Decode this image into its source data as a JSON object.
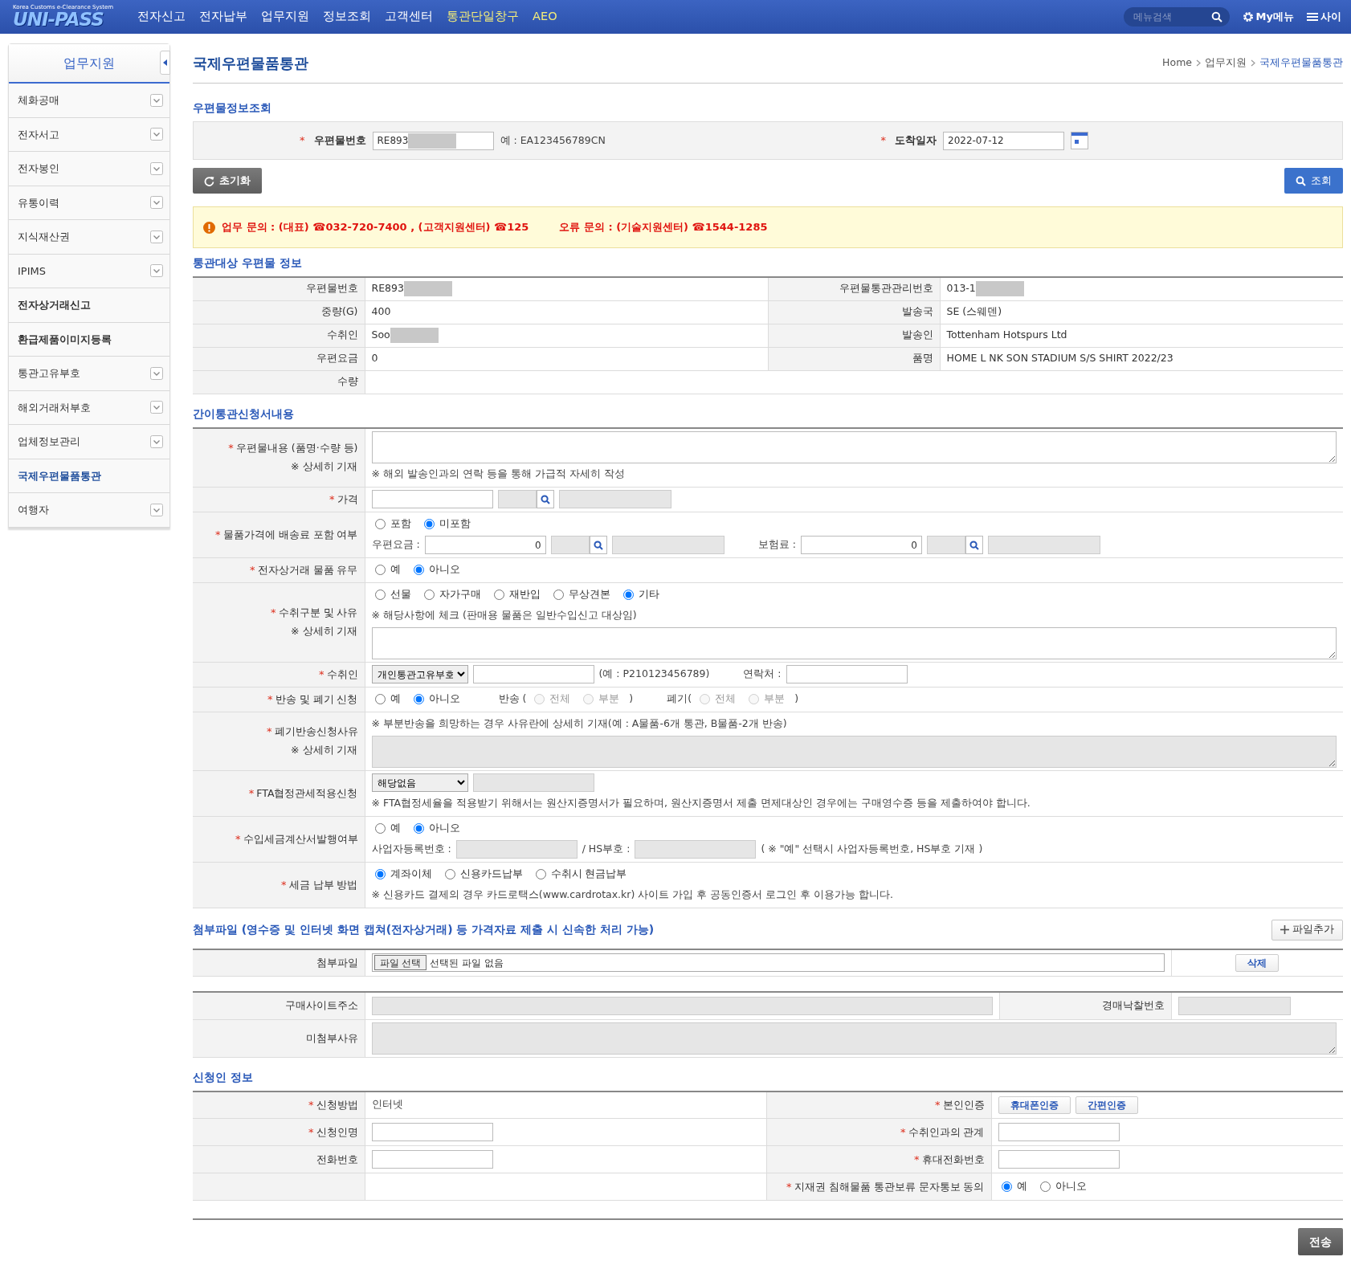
{
  "topbar": {
    "logo": "UNI-PASS",
    "logo_sub": "Korea Customs e-Clearance System",
    "menu": [
      {
        "label": "전자신고",
        "highlight": false
      },
      {
        "label": "전자납부",
        "highlight": false
      },
      {
        "label": "업무지원",
        "highlight": false
      },
      {
        "label": "정보조회",
        "highlight": false
      },
      {
        "label": "고객센터",
        "highlight": false
      },
      {
        "label": "통관단일창구",
        "highlight": true
      },
      {
        "label": "AEO",
        "highlight": true
      }
    ],
    "search": {
      "placeholder": "메뉴검색"
    },
    "my_menu": "My메뉴",
    "sitemap": "사이"
  },
  "sidebar": {
    "title": "업무지원",
    "items": [
      {
        "label": "체화공매",
        "expandable": true,
        "selected": false
      },
      {
        "label": "전자서고",
        "expandable": true,
        "selected": false
      },
      {
        "label": "전자봉인",
        "expandable": true,
        "selected": false
      },
      {
        "label": "유통이력",
        "expandable": true,
        "selected": false
      },
      {
        "label": "지식재산권",
        "expandable": true,
        "selected": false
      },
      {
        "label": "IPIMS",
        "expandable": true,
        "selected": false
      },
      {
        "label": "전자상거래신고",
        "expandable": false,
        "selected": false
      },
      {
        "label": "환급제품이미지등록",
        "expandable": false,
        "selected": false
      },
      {
        "label": "통관고유부호",
        "expandable": true,
        "selected": false
      },
      {
        "label": "해외거래처부호",
        "expandable": true,
        "selected": false
      },
      {
        "label": "업체정보관리",
        "expandable": true,
        "selected": false
      },
      {
        "label": "국제우편물품통관",
        "expandable": false,
        "selected": true
      },
      {
        "label": "여행자",
        "expandable": true,
        "selected": false
      }
    ]
  },
  "page": {
    "title": "국제우편물품통관",
    "breadcrumb": [
      {
        "label": "Home",
        "current": false
      },
      {
        "label": "업무지원",
        "current": false
      },
      {
        "label": "국제우편물품통관",
        "current": true
      }
    ]
  },
  "lookup": {
    "title": "우편물정보조회",
    "postal_no": {
      "star": "*",
      "label": "우편물번호",
      "value": "RE893",
      "masked": true,
      "example": "예 : EA123456789CN"
    },
    "arrival": {
      "star": "*",
      "label": "도착일자",
      "value": "2022-07-12"
    },
    "reset_button": "초기화",
    "search_button": "조회"
  },
  "notice": {
    "parts": [
      "업무 문의 : (대표) ☎032-720-7400 , (고객지원센터) ☎125",
      "오류 문의 : (기술지원센터) ☎1544-1285"
    ]
  },
  "info": {
    "title": "통관대상 우편물 정보",
    "rows": [
      [
        {
          "label": "우편물번호",
          "value": "RE893",
          "masked": true
        },
        {
          "label": "우편물통관관리번호",
          "value": "013-1",
          "masked": true
        }
      ],
      [
        {
          "label": "중량(G)",
          "value": "400",
          "masked": false
        },
        {
          "label": "발송국",
          "value": "SE (스웨덴)",
          "masked": false
        }
      ],
      [
        {
          "label": "수취인",
          "value": "Soo",
          "masked": true
        },
        {
          "label": "발송인",
          "value": "Tottenham Hotspurs Ltd",
          "masked": false
        }
      ],
      [
        {
          "label": "우편요금",
          "value": "0",
          "masked": false
        },
        {
          "label": "품명",
          "value": "HOME L NK SON STADIUM S/S SHIRT 2022/23",
          "masked": false
        }
      ],
      [
        {
          "label": "수량",
          "masked": false
        }
      ]
    ]
  },
  "form": {
    "title": "간이통관신청서내용",
    "rows": [
      {
        "star": "*",
        "label": "우편물내용 (품명·수량 등)",
        "note": "※ 상세히 기재",
        "lines": [
          [
            {
              "kind": "textarea",
              "disabled": false
            }
          ],
          [
            {
              "kind": "note",
              "text": "※ 해외 발송인과의 연락 등을 통해 가급적 자세히 작성"
            }
          ]
        ]
      },
      {
        "star": "*",
        "label": "가격",
        "lines": [
          [
            {
              "kind": "input",
              "disabled": false
            },
            {
              "kind": "lookup"
            }
          ]
        ]
      },
      {
        "star": "*",
        "label": "물품가격에 배송료 포함 여부",
        "lines": [
          [
            {
              "kind": "radio",
              "label": "포함",
              "checked": false,
              "disabled": false
            },
            {
              "kind": "radio",
              "label": "미포함",
              "checked": true,
              "disabled": false
            }
          ],
          [
            {
              "kind": "text",
              "text": "우편요금 :"
            },
            {
              "kind": "amount",
              "value": "0"
            },
            {
              "kind": "lookup"
            },
            {
              "kind": "gap"
            },
            {
              "kind": "text",
              "text": "보험료 :"
            },
            {
              "kind": "amount",
              "value": "0"
            },
            {
              "kind": "lookup"
            }
          ]
        ]
      },
      {
        "star": "*",
        "label": "전자상거래 물품 유무",
        "lines": [
          [
            {
              "kind": "radio",
              "label": "예",
              "checked": false,
              "disabled": false
            },
            {
              "kind": "radio",
              "label": "아니오",
              "checked": true,
              "disabled": false
            }
          ]
        ]
      },
      {
        "star": "*",
        "label": "수취구분 및 사유",
        "note": "※ 상세히 기재",
        "lines": [
          [
            {
              "kind": "radio",
              "label": "선물",
              "checked": false,
              "disabled": false
            },
            {
              "kind": "radio",
              "label": "자가구매",
              "checked": false,
              "disabled": false
            },
            {
              "kind": "radio",
              "label": "재반입",
              "checked": false,
              "disabled": false
            },
            {
              "kind": "radio",
              "label": "무상견본",
              "checked": false,
              "disabled": false
            },
            {
              "kind": "radio",
              "label": "기타",
              "checked": true,
              "disabled": false
            }
          ],
          [
            {
              "kind": "note",
              "text": "※ 해당사항에 체크 (판매용 물품은 일반수입신고 대상임)"
            }
          ],
          [
            {
              "kind": "textarea",
              "disabled": false
            }
          ]
        ]
      },
      {
        "star": "*",
        "label": "수취인",
        "lines": [
          [
            {
              "kind": "select",
              "value": "개인통관고유부호"
            },
            {
              "kind": "input",
              "disabled": false
            },
            {
              "kind": "text",
              "text": "(예 : P210123456789)"
            },
            {
              "kind": "gap"
            },
            {
              "kind": "text",
              "text": "연락처 :"
            },
            {
              "kind": "input",
              "disabled": false
            }
          ]
        ]
      },
      {
        "star": "*",
        "label": "반송 및 폐기 신청",
        "lines": [
          [
            {
              "kind": "radio",
              "label": "예",
              "checked": false,
              "disabled": false
            },
            {
              "kind": "radio",
              "label": "아니오",
              "checked": true,
              "disabled": false
            },
            {
              "kind": "gap"
            },
            {
              "kind": "text",
              "text": "반송 ("
            },
            {
              "kind": "radio",
              "label": "전체",
              "checked": false,
              "disabled": true
            },
            {
              "kind": "radio",
              "label": "부분",
              "checked": false,
              "disabled": true
            },
            {
              "kind": "text",
              "text": ")"
            },
            {
              "kind": "gap"
            },
            {
              "kind": "text",
              "text": "폐기("
            },
            {
              "kind": "radio",
              "label": "전체",
              "checked": false,
              "disabled": true
            },
            {
              "kind": "radio",
              "label": "부분",
              "checked": false,
              "disabled": true
            },
            {
              "kind": "text",
              "text": ")"
            }
          ]
        ]
      },
      {
        "star": "*",
        "label": "폐기반송신청사유",
        "note": "※ 상세히 기재",
        "lines": [
          [
            {
              "kind": "note",
              "text": "※ 부분반송을 희망하는 경우 사유란에 상세히 기재(예 : A물품-6개 통관, B물품-2개 반송)"
            }
          ],
          [
            {
              "kind": "textarea",
              "disabled": true
            }
          ]
        ]
      },
      {
        "star": "*",
        "label": "FTA협정관세적용신청",
        "lines": [
          [
            {
              "kind": "select",
              "value": "해당없음"
            },
            {
              "kind": "input",
              "disabled": true
            }
          ],
          [
            {
              "kind": "note",
              "text": "※ FTA협정세율을 적용받기 위해서는 원산지증명서가 필요하며, 원산지증명서 제출 면제대상인 경우에는 구매영수증 등을 제출하여야 합니다."
            }
          ]
        ]
      },
      {
        "star": "*",
        "label": "수입세금계산서발행여부",
        "lines": [
          [
            {
              "kind": "radio",
              "label": "예",
              "checked": false,
              "disabled": false
            },
            {
              "kind": "radio",
              "label": "아니오",
              "checked": true,
              "disabled": false
            }
          ],
          [
            {
              "kind": "text",
              "text": "사업자등록번호 :"
            },
            {
              "kind": "input",
              "disabled": true
            },
            {
              "kind": "text",
              "text": "/ HS부호 :"
            },
            {
              "kind": "input",
              "disabled": true
            },
            {
              "kind": "text",
              "text": "( ※ \"예\" 선택시 사업자등록번호, HS부호 기재 )"
            }
          ]
        ]
      },
      {
        "star": "*",
        "label": "세금 납부 방법",
        "lines": [
          [
            {
              "kind": "radio",
              "label": "계좌이체",
              "checked": true,
              "disabled": false
            },
            {
              "kind": "radio",
              "label": "신용카드납부",
              "checked": false,
              "disabled": false
            },
            {
              "kind": "radio",
              "label": "수취시 현금납부",
              "checked": false,
              "disabled": false
            }
          ],
          [
            {
              "kind": "note",
              "text": "※ 신용카드 결제의 경우 카드로택스(www.cardrotax.kr) 사이트 가입 후 공동인증서 로그인 후 이용가능 합니다."
            }
          ]
        ]
      }
    ]
  },
  "attachments": {
    "title": "첨부파일 (영수증 및 인터넷 화면 캡쳐(전자상거래) 등 가격자료 제출 시 신속한 처리 가능)",
    "add_button": "파일추가",
    "label": "첨부파일",
    "choose_button": "파일 선택",
    "file_status": "선택된 파일 없음",
    "delete_button": "삭제"
  },
  "purchase": {
    "rows": [
      [
        {
          "label": "구매사이트주소",
          "items": [
            {
              "kind": "input",
              "disabled": true
            }
          ]
        },
        {
          "label": "경매낙찰번호",
          "items": [
            {
              "kind": "input",
              "disabled": true
            }
          ]
        }
      ],
      [
        {
          "label": "미첨부사유",
          "items": [
            {
              "kind": "textarea",
              "disabled": true
            }
          ]
        }
      ]
    ]
  },
  "applicant": {
    "title": "신청인 정보",
    "rows": [
      [
        {
          "star": "*",
          "label": "신청방법",
          "items": [
            {
              "kind": "text",
              "text": "인터넷"
            }
          ]
        },
        {
          "star": "*",
          "label": "본인인증",
          "items": [
            {
              "kind": "button",
              "label": "휴대폰인증"
            },
            {
              "kind": "button",
              "label": "간편인증"
            }
          ]
        }
      ],
      [
        {
          "star": "*",
          "label": "신청인명",
          "items": [
            {
              "kind": "input",
              "disabled": false
            }
          ]
        },
        {
          "star": "*",
          "label": "수취인과의 관계",
          "items": [
            {
              "kind": "input",
              "disabled": false
            }
          ]
        }
      ],
      [
        {
          "label": "전화번호",
          "items": [
            {
              "kind": "input",
              "disabled": false
            }
          ]
        },
        {
          "star": "*",
          "label": "휴대전화번호",
          "items": [
            {
              "kind": "input",
              "disabled": false
            }
          ]
        }
      ],
      [
        {},
        {
          "star": "*",
          "label": "지재권 침해물품 통관보류 문자통보 동의",
          "items": [
            {
              "kind": "radio",
              "label": "예",
              "checked": true,
              "disabled": false
            },
            {
              "kind": "radio",
              "label": "아니오",
              "checked": false,
              "disabled": false
            }
          ]
        }
      ]
    ]
  },
  "submit_button": "전송"
}
